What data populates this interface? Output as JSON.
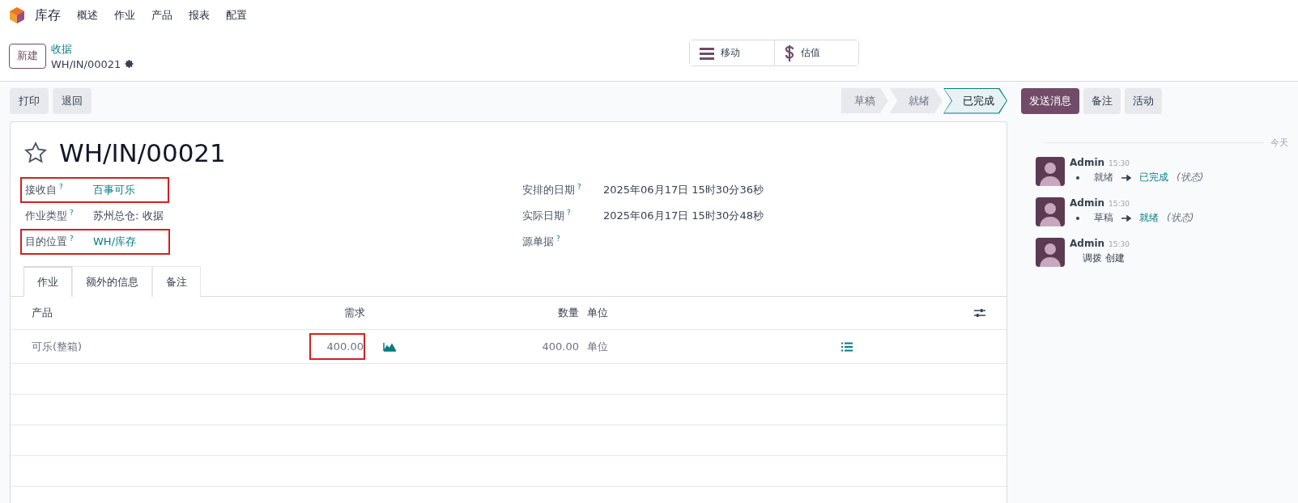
{
  "navbar": {
    "app_name": "库存",
    "menu": [
      "概述",
      "作业",
      "产品",
      "报表",
      "配置"
    ]
  },
  "control_panel": {
    "new_button": "新建",
    "breadcrumb": "收据",
    "record_name": "WH/IN/00021",
    "smart_buttons": [
      {
        "kind": "moves",
        "label": "移动"
      },
      {
        "kind": "valuation",
        "label": "估值"
      }
    ]
  },
  "actions": [
    "打印",
    "退回"
  ],
  "status_bar": [
    {
      "label": "草稿",
      "selected": false
    },
    {
      "label": "就绪",
      "selected": false
    },
    {
      "label": "已完成",
      "selected": true
    }
  ],
  "chatter_buttons": [
    {
      "label": "发送消息",
      "primary": true
    },
    {
      "label": "备注",
      "primary": false
    },
    {
      "label": "活动",
      "primary": false
    }
  ],
  "form": {
    "title": "WH/IN/00021",
    "starred": false,
    "left_fields": [
      {
        "label": "接收自",
        "help": "?",
        "value": "百事可乐",
        "link": true,
        "highlighted": true
      },
      {
        "label": "作业类型",
        "help": "?",
        "value": "苏州总仓: 收据",
        "link": false,
        "highlighted": false
      },
      {
        "label": "目的位置",
        "help": "?",
        "value": "WH/库存",
        "link": true,
        "highlighted": true
      }
    ],
    "right_fields": [
      {
        "label": "安排的日期",
        "help": "?",
        "value": "2025年06月17日 15时30分36秒"
      },
      {
        "label": "实际日期",
        "help": "?",
        "value": "2025年06月17日 15时30分48秒"
      },
      {
        "label": "源单据",
        "help": "?"
      }
    ],
    "tabs": [
      {
        "label": "作业",
        "selected": true
      },
      {
        "label": "额外的信息",
        "selected": false
      },
      {
        "label": "备注",
        "selected": false
      }
    ],
    "table": {
      "columns": [
        "产品",
        "需求",
        "数量",
        "单位"
      ],
      "rows": [
        {
          "product": "可乐(整箱)",
          "demand": "400.00",
          "demand_highlighted": true,
          "quantity": "400.00",
          "unit": "单位"
        }
      ]
    }
  },
  "chatter": {
    "date_label": "今天",
    "messages": [
      {
        "author": "Admin",
        "time": "15:30",
        "kind": "tracking",
        "from": "就绪",
        "to": "已完成",
        "field": "(状态)"
      },
      {
        "author": "Admin",
        "time": "15:30",
        "kind": "tracking",
        "from": "草稿",
        "to": "就绪",
        "field": "(状态)"
      },
      {
        "author": "Admin",
        "time": "15:30",
        "kind": "text",
        "body": "调拨 创建"
      }
    ]
  }
}
